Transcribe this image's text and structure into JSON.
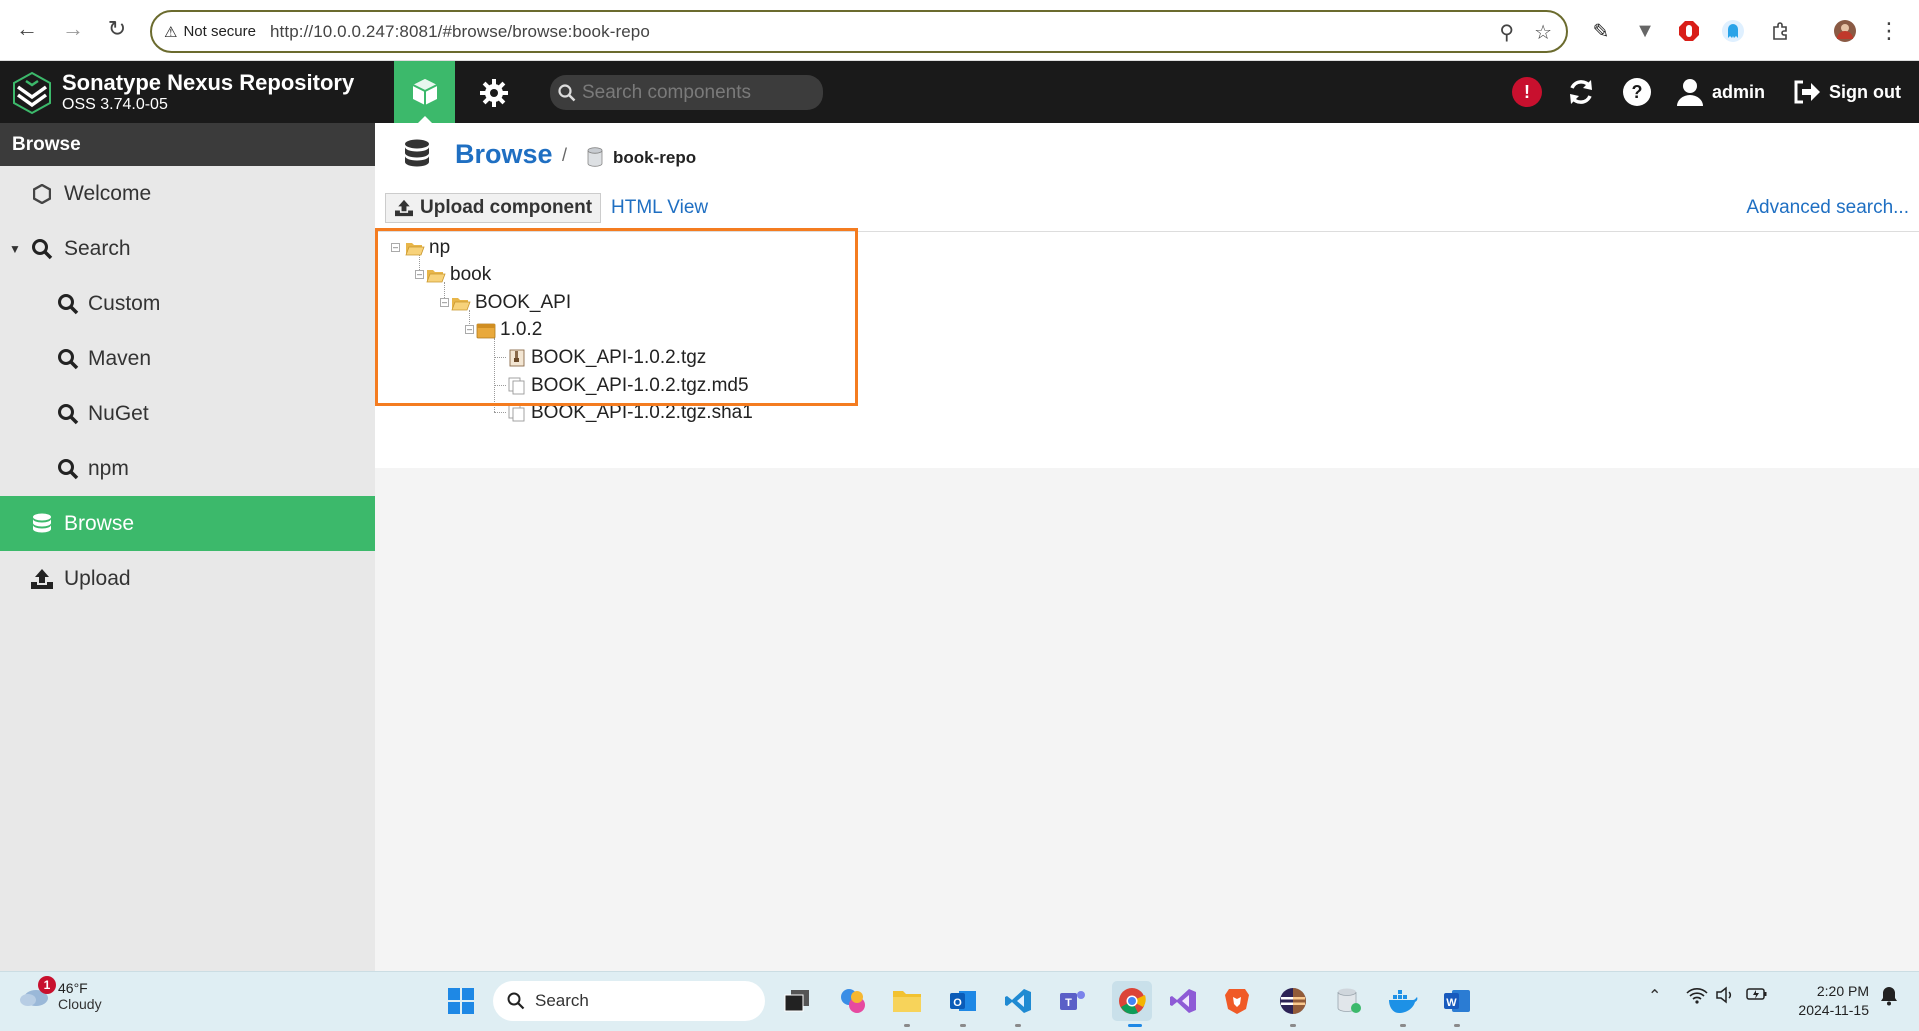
{
  "browser": {
    "security_label": "Not secure",
    "url": "http://10.0.0.247:8081/#browse/browse:book-repo"
  },
  "app": {
    "title": "Sonatype Nexus Repository",
    "version": "OSS 3.74.0-05",
    "search_placeholder": "Search components",
    "user": "admin",
    "sign_out": "Sign out"
  },
  "sidebar": {
    "header": "Browse",
    "items": [
      {
        "label": "Welcome",
        "icon": "hexagon-icon"
      },
      {
        "label": "Search",
        "icon": "search-icon"
      },
      {
        "label": "Custom",
        "icon": "search-icon"
      },
      {
        "label": "Maven",
        "icon": "search-icon"
      },
      {
        "label": "NuGet",
        "icon": "search-icon"
      },
      {
        "label": "npm",
        "icon": "search-icon"
      },
      {
        "label": "Browse",
        "icon": "database-icon",
        "active": true
      },
      {
        "label": "Upload",
        "icon": "upload-icon"
      }
    ]
  },
  "main": {
    "breadcrumb_title": "Browse",
    "breadcrumb_sep": "/",
    "repo_name": "book-repo",
    "upload_button": "Upload component",
    "html_view": "HTML View",
    "advanced_search": "Advanced search...",
    "tree": [
      {
        "label": "np",
        "type": "folder"
      },
      {
        "label": "book",
        "type": "folder"
      },
      {
        "label": "BOOK_API",
        "type": "folder"
      },
      {
        "label": "1.0.2",
        "type": "component"
      },
      {
        "label": "BOOK_API-1.0.2.tgz",
        "type": "archive"
      },
      {
        "label": "BOOK_API-1.0.2.tgz.md5",
        "type": "file"
      },
      {
        "label": "BOOK_API-1.0.2.tgz.sha1",
        "type": "file"
      }
    ]
  },
  "taskbar": {
    "weather_temp": "46°F",
    "weather_cond": "Cloudy",
    "weather_badge": "1",
    "search_label": "Search",
    "time": "2:20 PM",
    "date": "2024-11-15"
  },
  "colors": {
    "accent_green": "#3cb96b",
    "link_blue": "#1f6fc2",
    "highlight_orange": "#f47c20",
    "header_dark": "#1a1a1a"
  }
}
